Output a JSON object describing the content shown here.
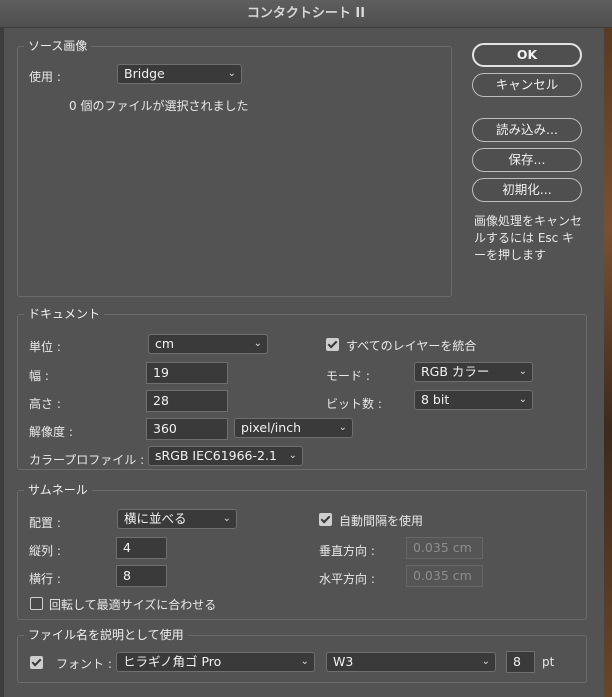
{
  "window": {
    "title": "コンタクトシート II"
  },
  "source": {
    "title": "ソース画像",
    "use_label": "使用 :",
    "use_value": "Bridge",
    "status": "0 個のファイルが選択されました"
  },
  "buttons": {
    "ok": "OK",
    "cancel": "キャンセル",
    "load": "読み込み...",
    "save": "保存...",
    "reset": "初期化...",
    "note": "画像処理をキャンセルするには Esc キーを押します"
  },
  "document": {
    "title": "ドキュメント",
    "unit_label": "単位 :",
    "unit_value": "cm",
    "width_label": "幅 :",
    "width_value": "19",
    "height_label": "高さ :",
    "height_value": "28",
    "resolution_label": "解像度 :",
    "resolution_value": "360",
    "resolution_unit": "pixel/inch",
    "profile_label": "カラープロファイル :",
    "profile_value": "sRGB IEC61966-2.1",
    "flatten_label": "すべてのレイヤーを統合",
    "flatten_checked": true,
    "mode_label": "モード :",
    "mode_value": "RGB カラー",
    "bitdepth_label": "ビット数 :",
    "bitdepth_value": "8 bit"
  },
  "thumbnails": {
    "title": "サムネール",
    "place_label": "配置 :",
    "place_value": "横に並べる",
    "columns_label": "縦列 :",
    "columns_value": "4",
    "rows_label": "横行 :",
    "rows_value": "8",
    "rotate_label": "回転して最適サイズに合わせる",
    "rotate_checked": false,
    "autospacing_label": "自動間隔を使用",
    "autospacing_checked": true,
    "vertical_label": "垂直方向 :",
    "vertical_value": "0.035 cm",
    "horizontal_label": "水平方向 :",
    "horizontal_value": "0.035 cm"
  },
  "caption": {
    "title": "ファイル名を説明として使用",
    "enabled": true,
    "font_label": "フォント :",
    "font_value": "ヒラギノ角ゴ Pro",
    "weight_value": "W3",
    "size_value": "8",
    "size_unit": "pt"
  },
  "icons": {
    "dropdown": "chevron-down-icon",
    "check": "checkmark-icon"
  }
}
